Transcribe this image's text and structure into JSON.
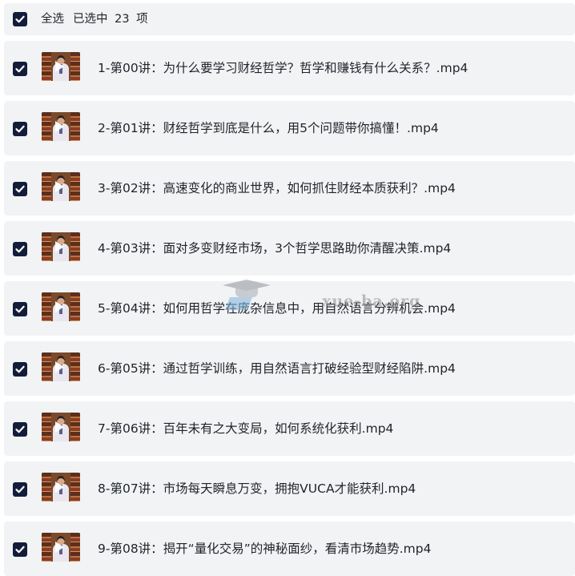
{
  "header": {
    "select_all_label": "全选",
    "selected_count": "已选中 23 项"
  },
  "files": [
    {
      "name": "1-第00讲：为什么要学习财经哲学？哲学和赚钱有什么关系？.mp4"
    },
    {
      "name": "2-第01讲：财经哲学到底是什么，用5个问题带你搞懂！.mp4"
    },
    {
      "name": "3-第02讲：高速变化的商业世界，如何抓住财经本质获利？.mp4"
    },
    {
      "name": "4-第03讲：面对多变财经市场，3个哲学思路助你清醒决策.mp4"
    },
    {
      "name": "5-第04讲：如何用哲学在庞杂信息中，用自然语言分辨机会.mp4"
    },
    {
      "name": "6-第05讲：通过哲学训练，用自然语言打破经验型财经陷阱.mp4"
    },
    {
      "name": "7-第06讲：百年未有之大变局，如何系统化获利.mp4"
    },
    {
      "name": "8-第07讲：市场每天瞬息万变，拥抱VUCA才能获利.mp4"
    },
    {
      "name": "9-第08讲：揭开“量化交易”的神秘面纱，看清市场趋势.mp4"
    }
  ],
  "watermark": {
    "text": "xue-ba.org"
  },
  "colors": {
    "checkbox": "#131d3a",
    "row_background": "#f2f3f5"
  }
}
